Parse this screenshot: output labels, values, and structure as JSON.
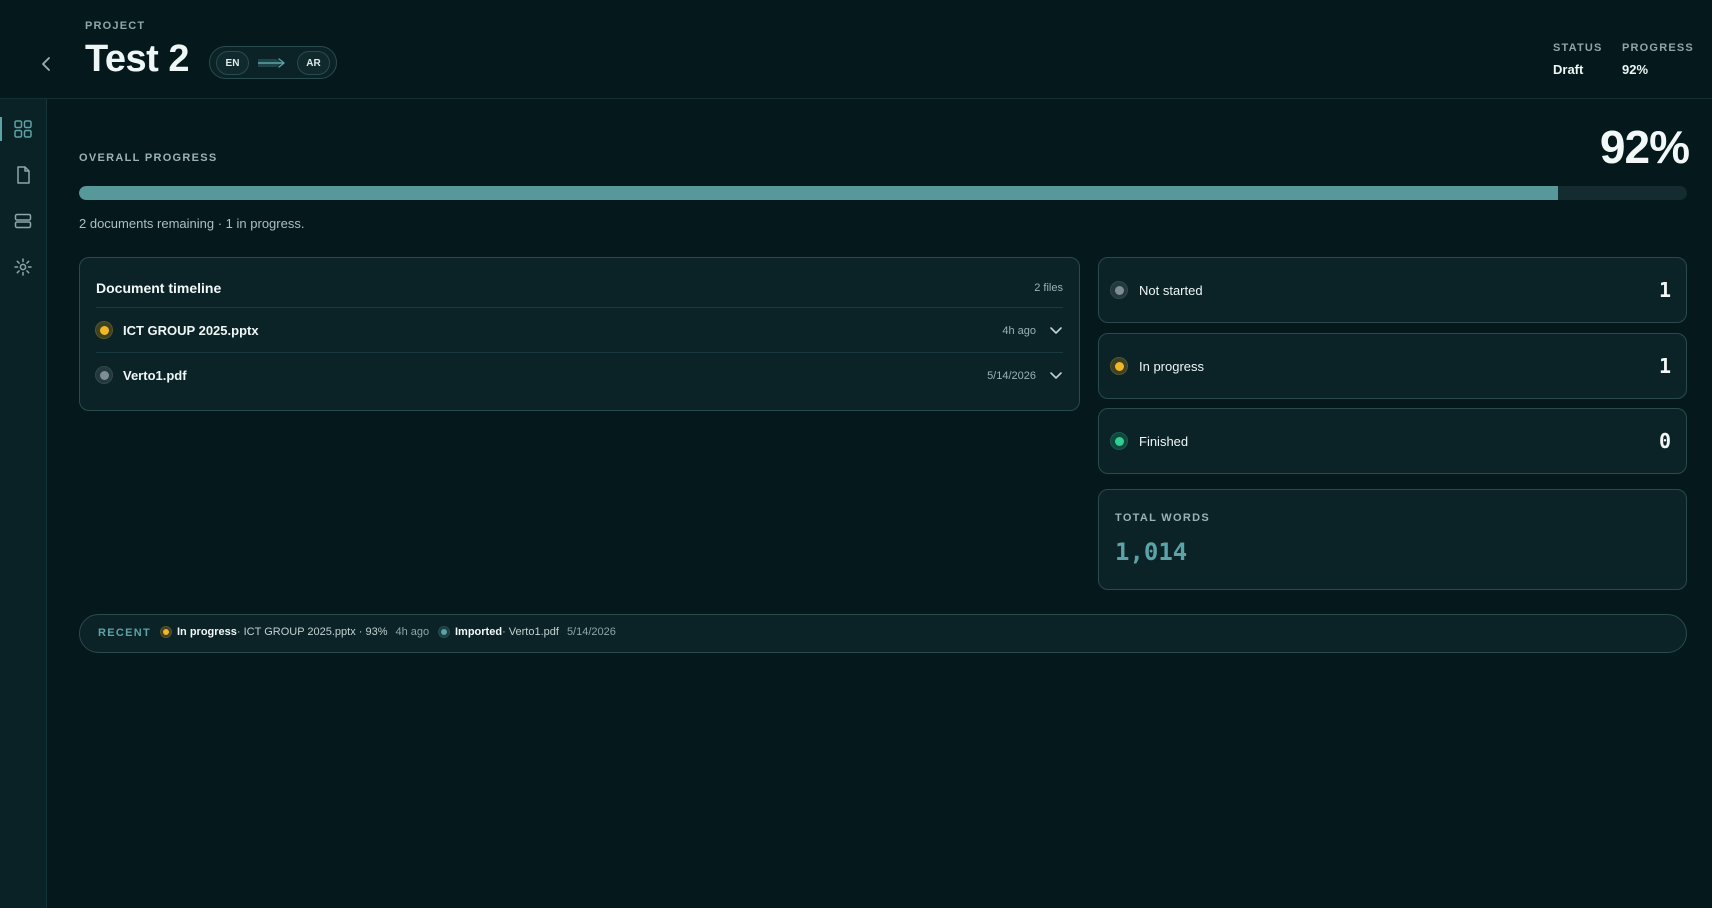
{
  "header": {
    "project_label": "PROJECT",
    "title": "Test 2",
    "source_lang": "EN",
    "target_lang": "AR",
    "status_label": "STATUS",
    "status_value": "Draft",
    "progress_label": "PROGRESS",
    "progress_value": "92%"
  },
  "sidebar": {
    "items": [
      {
        "name": "dashboard",
        "icon": "grid-icon",
        "active": true
      },
      {
        "name": "documents",
        "icon": "document-icon",
        "active": false
      },
      {
        "name": "storage",
        "icon": "stack-icon",
        "active": false
      },
      {
        "name": "settings",
        "icon": "gear-icon",
        "active": false
      }
    ]
  },
  "overall": {
    "label": "OVERALL PROGRESS",
    "percent_text": "92%",
    "progress_fraction": 0.92,
    "subtitle": "2 documents remaining · 1 in progress."
  },
  "timeline": {
    "title": "Document timeline",
    "count": "2 files",
    "rows": [
      {
        "name": "ICT GROUP 2025.pptx",
        "time": "4h ago",
        "status_color": "#f2b824"
      },
      {
        "name": "Verto1.pdf",
        "time": "5/14/2026",
        "status_color": "#7d8f92"
      }
    ]
  },
  "stats": [
    {
      "label": "Not started",
      "count": "1",
      "color": "#7d8f92"
    },
    {
      "label": "In progress",
      "count": "1",
      "color": "#f2b824"
    },
    {
      "label": "Finished",
      "count": "0",
      "color": "#2fcf96"
    }
  ],
  "words": {
    "label": "TOTAL WORDS",
    "value": "1,014"
  },
  "recent": {
    "label": "RECENT",
    "items": [
      {
        "status": "In progress",
        "detail": " · ICT GROUP 2025.pptx · 93%",
        "time": "4h ago",
        "color": "#f2b824"
      },
      {
        "status": "Imported",
        "detail": " · Verto1.pdf",
        "time": "5/14/2026",
        "color": "#5ba3a6"
      }
    ]
  },
  "colors": {
    "accent": "#5ba3a6",
    "background": "#05181b",
    "card": "#0b2226",
    "yellow": "#f2b824",
    "green": "#2fcf96",
    "gray": "#7d8f92"
  }
}
